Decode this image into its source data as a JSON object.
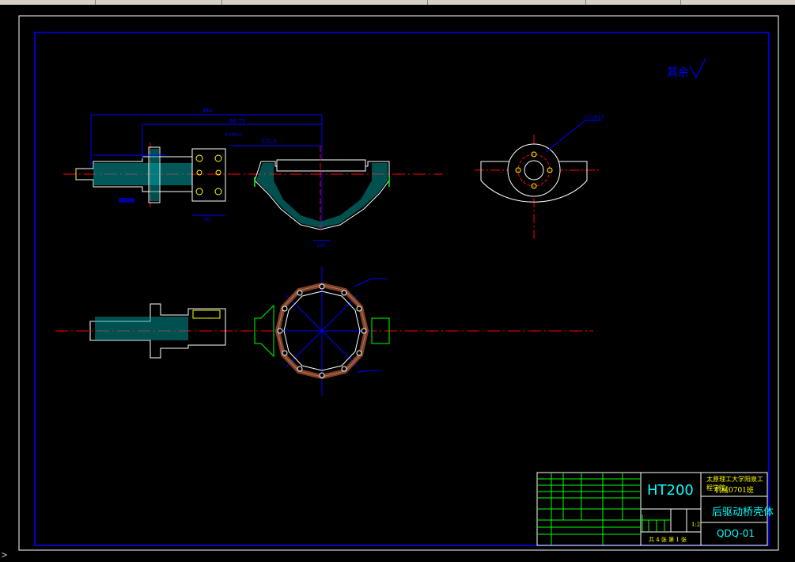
{
  "note_text": "其余",
  "title_block": {
    "material": "HT200",
    "school": "太原理工大学阳泉学院机械0701班",
    "school_line1": "太原理工大学阳泉工程学院",
    "school_line2": "机械0701班",
    "part_name": "后驱动桥壳体",
    "drawing_no": "QDQ-01",
    "scale": "1:2",
    "sheet_info": "共 4 张 第 1 张",
    "sheet_total": "4",
    "sheet_current": "1"
  },
  "dimension_labels": {
    "overall_length": "384",
    "length_2": "66.75",
    "length_3": "171.5",
    "flange_width": "80",
    "bottom_width": "120",
    "bolt_note": "4×M10",
    "hole_note": "12×Φ12"
  },
  "command_prompt": ">"
}
